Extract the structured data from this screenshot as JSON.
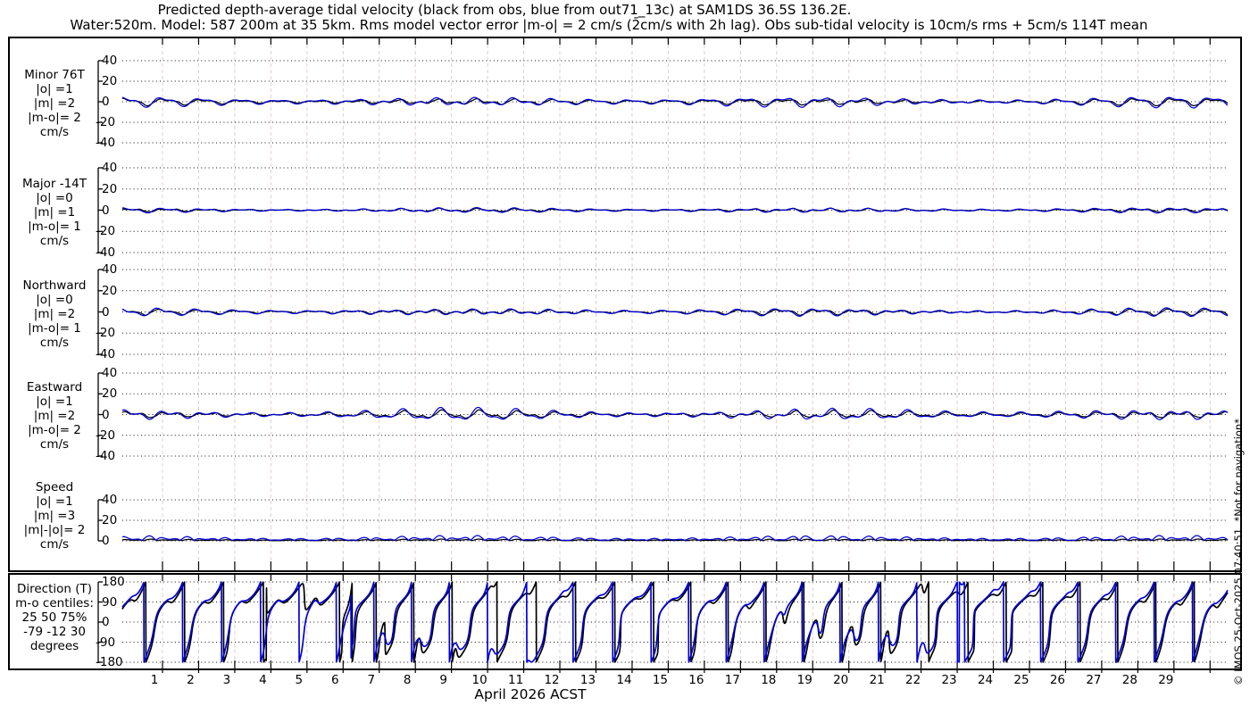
{
  "title": {
    "line1": "Predicted depth-average tidal velocity (black from obs, blue from out71_13c) at SAM1DS 36.5S 136.2E.",
    "line2": "Water:520m. Model: 587 200m at 35 5km. Rms model vector error |m-o| = 2 cm/s (2̄cm/s with 2h lag). Obs sub-tidal velocity is 10cm/s rms + 5cm/s 114T mean"
  },
  "watermark": "© IMOS 25-Oct-2025 07:40:51. *Not for navigation*",
  "colors": {
    "obs": "#000000",
    "model": "#0000dd",
    "grid_vertical": "#e0cfcf",
    "grid_horizontal": "#111111",
    "frame": "#000000"
  },
  "x_axis": {
    "label": "April 2026 ACST",
    "day_labels": [
      "1",
      "2",
      "3",
      "4",
      "5",
      "6",
      "7",
      "8",
      "9",
      "10",
      "11",
      "12",
      "13",
      "14",
      "15",
      "16",
      "17",
      "18",
      "19",
      "20",
      "21",
      "22",
      "23",
      "24",
      "25",
      "26",
      "27",
      "28",
      "29"
    ],
    "n_day_ticks": 30,
    "t_span_days": 30.6,
    "first_tick_day_offset": 1.111
  },
  "chart_data": {
    "type": "line",
    "legend": {
      "black": "obs",
      "blue": "out71_13c model"
    },
    "springneap_modulation": {
      "amp": 0.45,
      "period_d": 9.8,
      "peak_day": 9.5
    },
    "panels": [
      {
        "id": "minor",
        "label_lines": [
          "Minor 76T",
          "|o| =1",
          "|m| =2",
          "|m-o|= 2",
          "cm/s"
        ],
        "unit": "cm/s",
        "ylim": [
          -40,
          40
        ],
        "yticks": [
          40,
          20,
          0,
          -20,
          -40
        ],
        "series": [
          {
            "name": "obs",
            "color": "obs",
            "offset": 0,
            "components": [
              [
                1.4,
                25.82,
                0.9
              ],
              [
                0.9,
                12.42,
                2.2
              ],
              [
                0.5,
                23.93,
                0.4
              ],
              [
                0.25,
                6.2,
                0.8
              ]
            ]
          },
          {
            "name": "model",
            "color": "model",
            "offset": 0,
            "components": [
              [
                2.3,
                25.82,
                1.25
              ],
              [
                1.3,
                12.42,
                2.6
              ],
              [
                0.7,
                23.93,
                0.2
              ]
            ]
          }
        ]
      },
      {
        "id": "major",
        "label_lines": [
          "Major -14T",
          "|o| =0",
          "|m| =1",
          "|m-o|= 1",
          "cm/s"
        ],
        "unit": "cm/s",
        "ylim": [
          -40,
          40
        ],
        "yticks": [
          40,
          20,
          0,
          -20,
          -40
        ],
        "series": [
          {
            "name": "obs",
            "color": "obs",
            "offset": 0,
            "components": [
              [
                0.7,
                25.82,
                0.4
              ],
              [
                0.5,
                12.42,
                1.8
              ],
              [
                0.2,
                6.2,
                2.5
              ]
            ]
          },
          {
            "name": "model",
            "color": "model",
            "offset": 0,
            "components": [
              [
                1.0,
                25.82,
                0.75
              ],
              [
                0.7,
                12.42,
                2.2
              ],
              [
                0.3,
                23.93,
                1.1
              ]
            ]
          }
        ]
      },
      {
        "id": "northward",
        "label_lines": [
          "Northward",
          "|o| =0",
          "|m| =2",
          "|m-o|= 1",
          "cm/s"
        ],
        "unit": "cm/s",
        "ylim": [
          -40,
          40
        ],
        "yticks": [
          40,
          20,
          0,
          -20,
          -40
        ],
        "series": [
          {
            "name": "obs",
            "color": "obs",
            "offset": 0,
            "components": [
              [
                1.1,
                25.82,
                1.6
              ],
              [
                0.8,
                12.42,
                2.8
              ],
              [
                0.4,
                23.93,
                0.5
              ],
              [
                0.2,
                6.2,
                1.5
              ]
            ]
          },
          {
            "name": "model",
            "color": "model",
            "offset": 0,
            "components": [
              [
                1.6,
                25.82,
                1.95
              ],
              [
                1.0,
                12.42,
                3.1
              ],
              [
                0.6,
                23.93,
                0.8
              ]
            ]
          }
        ]
      },
      {
        "id": "eastward",
        "label_lines": [
          "Eastward",
          "|o| =1",
          "|m| =2",
          "|m-o|= 2",
          "cm/s"
        ],
        "unit": "cm/s",
        "ylim": [
          -40,
          40
        ],
        "yticks": [
          40,
          20,
          0,
          -20,
          -40
        ],
        "series": [
          {
            "name": "obs",
            "color": "obs",
            "offset": 0,
            "components": [
              [
                1.6,
                25.82,
                0.0
              ],
              [
                1.0,
                12.42,
                1.2
              ],
              [
                0.5,
                23.93,
                2.1
              ],
              [
                0.25,
                6.2,
                0.3
              ]
            ]
          },
          {
            "name": "model",
            "color": "model",
            "offset": 0,
            "components": [
              [
                2.6,
                25.82,
                0.35
              ],
              [
                1.5,
                12.42,
                1.5
              ],
              [
                0.8,
                23.93,
                2.4
              ]
            ]
          }
        ]
      },
      {
        "id": "speed",
        "label_lines": [
          "Speed",
          "|o| =1",
          "|m| =3",
          "|m|-|o|= 2",
          "cm/s"
        ],
        "unit": "cm/s",
        "ylim": [
          0,
          40
        ],
        "yticks": [
          40,
          20,
          0
        ],
        "series": [
          {
            "name": "obs",
            "color": "obs",
            "rectify": true,
            "offset": 0.2,
            "components": [
              [
                0.7,
                25.82,
                0.2
              ],
              [
                0.4,
                12.42,
                1.3
              ]
            ]
          },
          {
            "name": "model",
            "color": "model",
            "rectify": true,
            "offset": 0.5,
            "components": [
              [
                2.1,
                25.82,
                0.55
              ],
              [
                1.2,
                12.42,
                1.7
              ]
            ]
          }
        ]
      },
      {
        "id": "direction",
        "label_lines": [
          "Direction (T)",
          "m-o centiles:",
          "25  50  75%",
          "-79 -12  30",
          "degrees"
        ],
        "unit": "degrees",
        "ylim": [
          -180,
          180
        ],
        "yticks": [
          180,
          90,
          0,
          -90,
          -180
        ],
        "series": [
          {
            "name": "obs",
            "color": "obs",
            "direction": true,
            "mean_uv": [
              1.0,
              -0.4
            ],
            "u_components": [
              [
                1.6,
                25.82,
                0.0
              ],
              [
                1.0,
                12.42,
                1.2
              ],
              [
                0.5,
                23.93,
                2.1
              ]
            ],
            "v_components": [
              [
                1.1,
                25.82,
                1.6
              ],
              [
                0.8,
                12.42,
                2.8
              ],
              [
                0.4,
                23.93,
                0.5
              ]
            ]
          },
          {
            "name": "model",
            "color": "model",
            "direction": true,
            "mean_uv": [
              1.2,
              -0.5
            ],
            "u_components": [
              [
                2.6,
                25.82,
                0.35
              ],
              [
                1.5,
                12.42,
                1.5
              ],
              [
                0.8,
                23.93,
                2.4
              ]
            ],
            "v_components": [
              [
                1.6,
                25.82,
                1.95
              ],
              [
                1.0,
                12.42,
                3.1
              ],
              [
                0.6,
                23.93,
                0.8
              ]
            ]
          }
        ]
      }
    ]
  }
}
